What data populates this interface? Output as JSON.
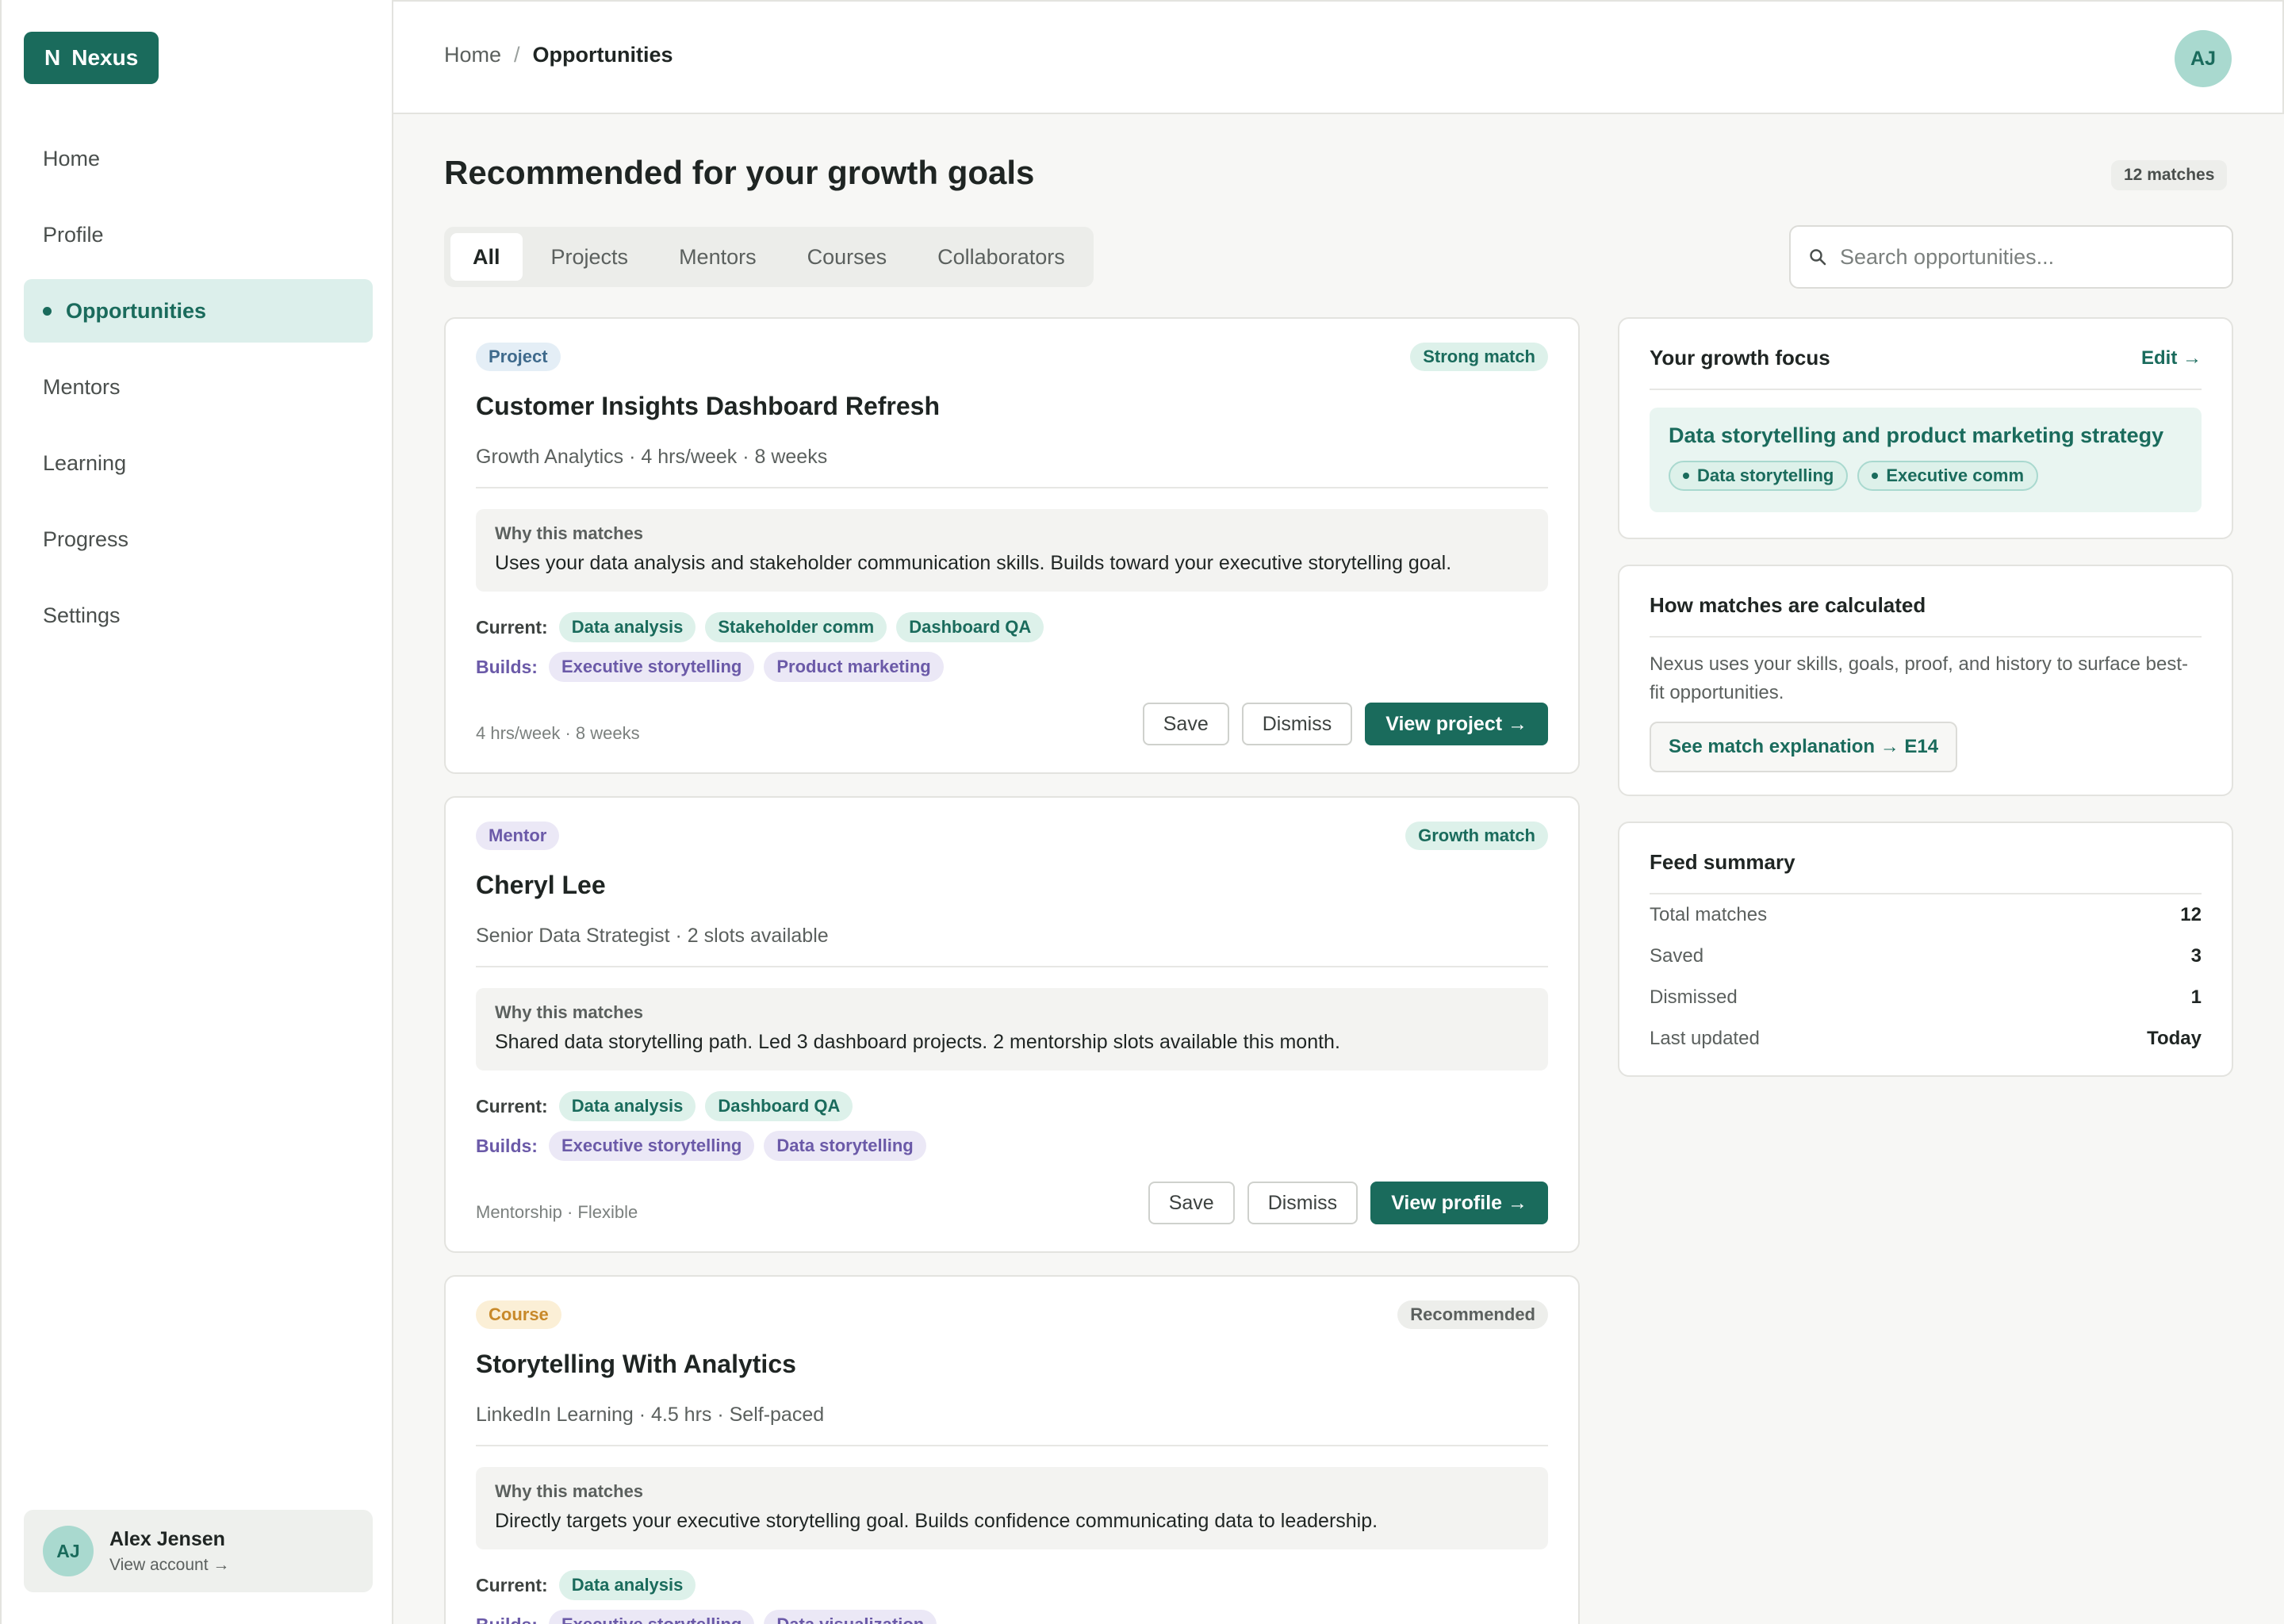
{
  "app": {
    "logo_mark": "N",
    "logo_text": "Nexus"
  },
  "sidebar": {
    "items": [
      {
        "label": "Home"
      },
      {
        "label": "Profile"
      },
      {
        "label": "Opportunities"
      },
      {
        "label": "Mentors"
      },
      {
        "label": "Learning"
      },
      {
        "label": "Progress"
      },
      {
        "label": "Settings"
      }
    ],
    "active": "Opportunities",
    "account": {
      "initials": "AJ",
      "name": "Alex Jensen",
      "link": "View account →"
    }
  },
  "header": {
    "breadcrumb": {
      "home": "Home",
      "separator": "/",
      "current": "Opportunities"
    },
    "avatar_initials": "AJ"
  },
  "main": {
    "title": "Recommended for your growth goals",
    "match_count": "12 matches",
    "tabs": [
      {
        "label": "All"
      },
      {
        "label": "Projects"
      },
      {
        "label": "Mentors"
      },
      {
        "label": "Courses"
      },
      {
        "label": "Collaborators"
      }
    ],
    "search": {
      "placeholder": "Search opportunities...",
      "icon": "search-icon"
    },
    "cards": [
      {
        "type": "Project",
        "match": "Strong match",
        "title": "Customer Insights Dashboard Refresh",
        "meta": "Growth Analytics · 4 hrs/week · 8 weeks",
        "why_label": "Why this matches",
        "why_text": "Uses your data analysis and stakeholder communication skills. Builds toward your executive storytelling goal.",
        "current_label": "Current:",
        "current": [
          "Data analysis",
          "Stakeholder comm",
          "Dashboard QA"
        ],
        "builds_label": "Builds:",
        "builds": [
          "Executive storytelling",
          "Product marketing"
        ],
        "footer": "4 hrs/week · 8 weeks",
        "save": "Save",
        "dismiss": "Dismiss",
        "primary": "View project →"
      },
      {
        "type": "Mentor",
        "match": "Growth match",
        "title": "Cheryl Lee",
        "meta": "Senior Data Strategist · 2 slots available",
        "why_label": "Why this matches",
        "why_text": "Shared data storytelling path. Led 3 dashboard projects. 2 mentorship slots available this month.",
        "current_label": "Current:",
        "current": [
          "Data analysis",
          "Dashboard QA"
        ],
        "builds_label": "Builds:",
        "builds": [
          "Executive storytelling",
          "Data storytelling"
        ],
        "footer": "Mentorship · Flexible",
        "save": "Save",
        "dismiss": "Dismiss",
        "primary": "View profile →"
      },
      {
        "type": "Course",
        "match": "Recommended",
        "title": "Storytelling With Analytics",
        "meta": "LinkedIn Learning · 4.5 hrs · Self-paced",
        "why_label": "Why this matches",
        "why_text": "Directly targets your executive storytelling goal. Builds confidence communicating data to leadership.",
        "current_label": "Current:",
        "current": [
          "Data analysis"
        ],
        "builds_label": "Builds:",
        "builds": [
          "Executive storytelling",
          "Data visualization"
        ]
      }
    ]
  },
  "growth_focus": {
    "title": "Your growth focus",
    "edit": "Edit →",
    "focus": "Data storytelling and product marketing strategy",
    "tags": [
      "Data storytelling",
      "Executive comm"
    ]
  },
  "how_matches": {
    "title": "How matches are calculated",
    "text": "Nexus uses your skills, goals, proof, and history to surface best-fit opportunities.",
    "button": "See match explanation → E14"
  },
  "feed_summary": {
    "title": "Feed summary",
    "rows": [
      {
        "label": "Total matches",
        "value": "12"
      },
      {
        "label": "Saved",
        "value": "3"
      },
      {
        "label": "Dismissed",
        "value": "1"
      },
      {
        "label": "Last updated",
        "value": "Today"
      }
    ]
  }
}
